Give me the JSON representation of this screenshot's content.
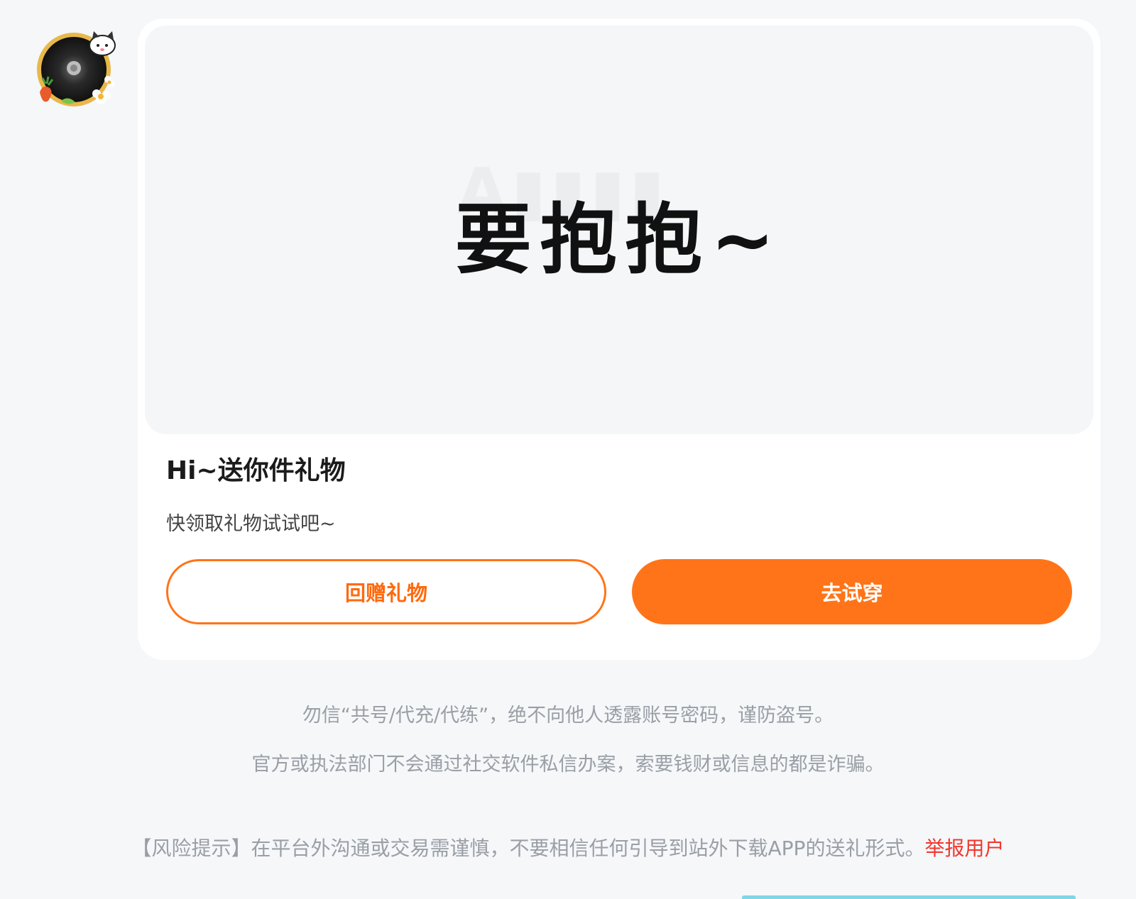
{
  "avatar": {
    "alt": "avatar"
  },
  "card": {
    "banner_text": "要抱抱~",
    "title": "Hi~送你件礼物",
    "subtitle": "快领取礼物试试吧~",
    "return_gift_label": "回赠礼物",
    "try_on_label": "去试穿"
  },
  "notices": [
    "勿信“共号/代充/代练”，绝不向他人透露账号密码，谨防盗号。",
    "官方或执法部门不会通过社交软件私信办案，索要钱财或信息的都是诈骗。"
  ],
  "risk": {
    "text": "【风险提示】在平台外沟通或交易需谨慎，不要相信任何引导到站外下载APP的送礼形式。",
    "report_label": "举报用户"
  },
  "colors": {
    "accent": "#ff7418",
    "report": "#f2362d",
    "muted_text": "#9a9fa6",
    "page_bg": "#f5f7f9"
  }
}
